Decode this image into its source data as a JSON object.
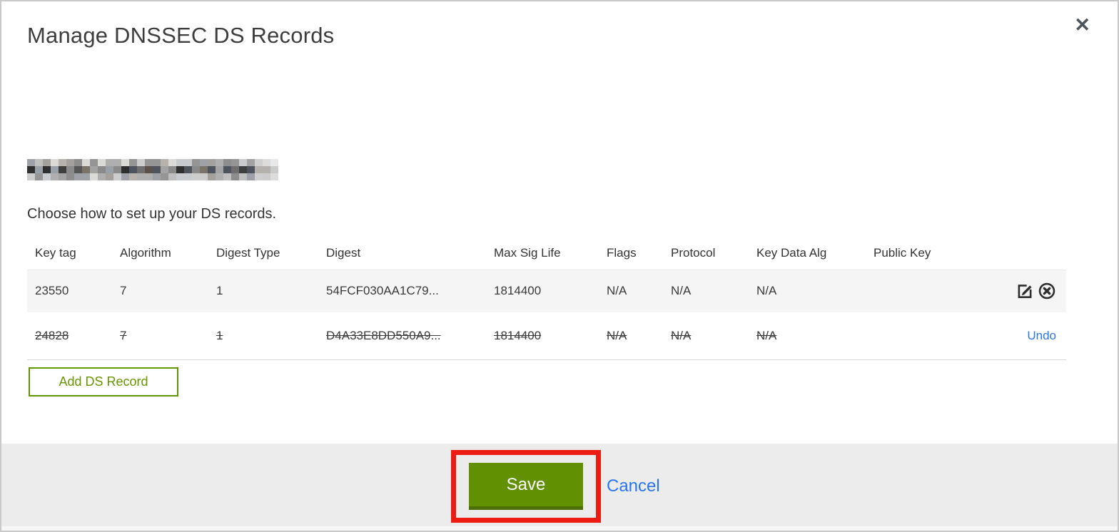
{
  "modal": {
    "title": "Manage DNSSEC DS Records",
    "close_glyph": "✕",
    "instruction": "Choose how to set up your DS records."
  },
  "table": {
    "columns": [
      "Key tag",
      "Algorithm",
      "Digest Type",
      "Digest",
      "Max Sig Life",
      "Flags",
      "Protocol",
      "Key Data Alg",
      "Public Key"
    ],
    "rows": [
      {
        "key_tag": "23550",
        "algorithm": "7",
        "digest_type": "1",
        "digest": "54FCF030AA1C79...",
        "max_sig_life": "1814400",
        "flags": "N/A",
        "protocol": "N/A",
        "key_data_alg": "N/A",
        "public_key": "",
        "state": "active",
        "actions": [
          "edit",
          "delete"
        ]
      },
      {
        "key_tag": "24828",
        "algorithm": "7",
        "digest_type": "1",
        "digest": "D4A33E8DD550A9...",
        "max_sig_life": "1814400",
        "flags": "N/A",
        "protocol": "N/A",
        "key_data_alg": "N/A",
        "public_key": "",
        "state": "deleted",
        "action_label": "Undo"
      }
    ]
  },
  "buttons": {
    "add_ds_record": "Add DS Record",
    "save": "Save",
    "cancel": "Cancel"
  },
  "colors": {
    "accent_green": "#619103",
    "accent_green_dark": "#4c7004",
    "outline_green": "#5f9602",
    "link_blue": "#2b76f0",
    "annotation_red": "#ec1c12",
    "row_stripe": "#f5f5f5",
    "footer_gray": "#ececec"
  }
}
